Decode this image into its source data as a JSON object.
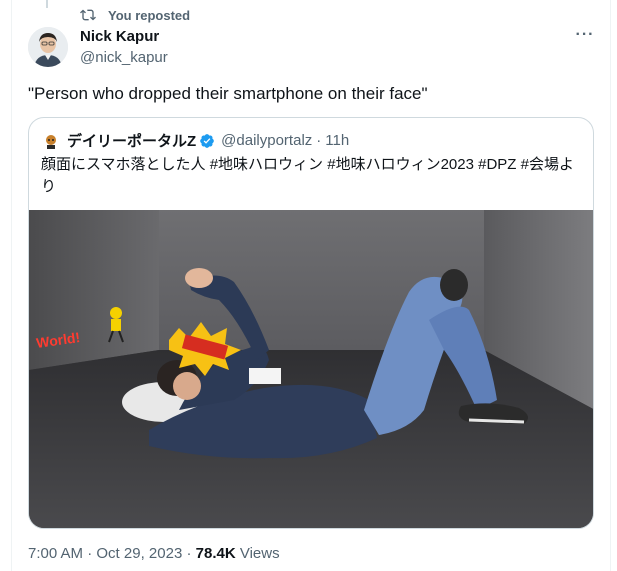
{
  "repost": {
    "label": "You reposted",
    "icon": "repost-icon"
  },
  "author": {
    "name": "Nick Kapur",
    "handle": "@nick_kapur",
    "avatar": "avatar"
  },
  "more": {
    "label": "···",
    "icon": "more-icon"
  },
  "tweet": {
    "text": "\"Person who dropped their smartphone on their face\""
  },
  "quote": {
    "name": "デイリーポータルZ",
    "handle": "@dailyportalz",
    "separator": "·",
    "time": "11h",
    "text": "顔面にスマホ落とした人 #地味ハロウィン #地味ハロウィン2023 #DPZ #会場より",
    "photo_sign_text": "World!",
    "verified_color": "#1d9bf0",
    "photo_description_icon": "photo"
  },
  "meta": {
    "time": "7:00 AM",
    "sep1": "·",
    "date": "Oct 29, 2023",
    "sep2": "·",
    "views": "78.4K",
    "views_label": "Views"
  }
}
